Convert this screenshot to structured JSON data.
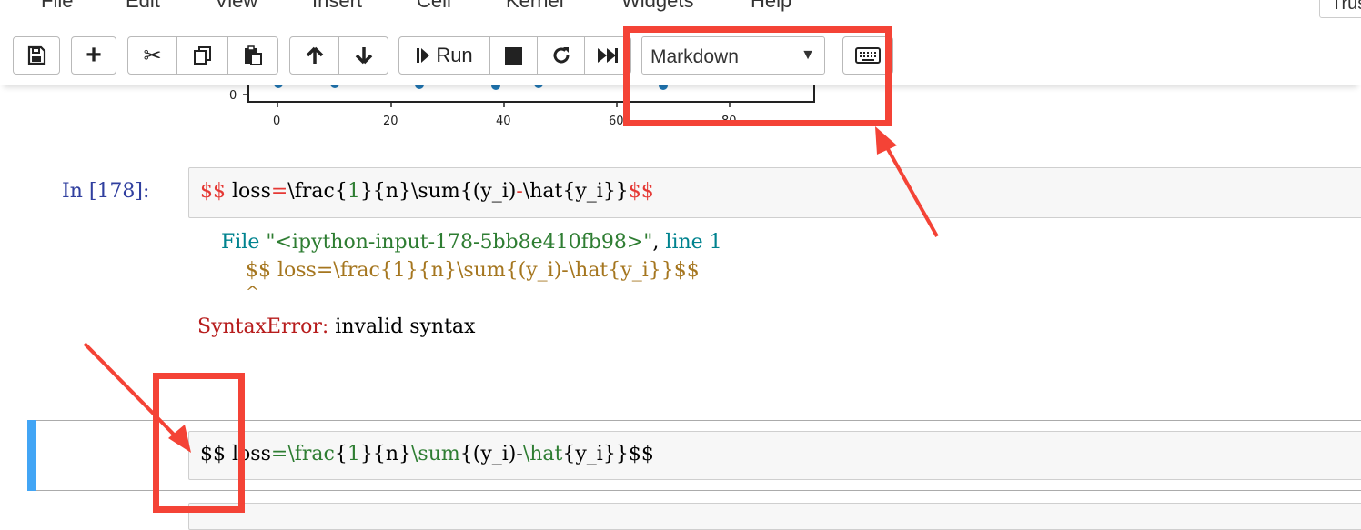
{
  "menubar": {
    "items": [
      "File",
      "Edit",
      "View",
      "Insert",
      "Cell",
      "Kernel",
      "Widgets",
      "Help"
    ],
    "trusted": "Trus"
  },
  "toolbar": {
    "run_label": "Run",
    "cell_type_value": "Markdown"
  },
  "plot": {
    "xticks": [
      "0",
      "20",
      "40",
      "60",
      "80"
    ],
    "yticks": [
      "0"
    ]
  },
  "cell1": {
    "prompt": "In  [178]:",
    "source_delim_open": "$$",
    "source_loss": " loss",
    "source_eq": "=",
    "source_frac": "\\frac",
    "source_b1": "{",
    "source_one": "1",
    "source_b2": "}{",
    "source_n": "n",
    "source_b3": "}",
    "source_sum": "\\sum",
    "source_b4": "{",
    "source_yi": "(y_i)",
    "source_minus": "-",
    "source_hat": "\\hat",
    "source_b5": "{",
    "source_yi2": "y_i",
    "source_b6": "}}",
    "source_delim_close": "$$"
  },
  "error": {
    "file_prefix": "File ",
    "file_name": "\"<ipython-input-178-5bb8e410fb98>\"",
    "file_sep": ", ",
    "line_label": "line 1",
    "code_line": "$$ loss=\\frac{1}{n}\\sum{(y_i)-\\hat{y_i}}$$",
    "caret": "^",
    "error_name": "SyntaxError:",
    "error_msg": " invalid syntax"
  },
  "cell2": {
    "s_open": "$$ ",
    "s_loss": "loss",
    "s_eq": "=",
    "s_frac": "\\frac",
    "s_b1": "{",
    "s_one": "1",
    "s_b2": "}{",
    "s_n": "n",
    "s_b3": "}",
    "s_sum": "\\sum",
    "s_b4": "{",
    "s_yi": "(y_i)-",
    "s_hat": "\\hat",
    "s_b5": "{",
    "s_yi2": "y_i",
    "s_b6": "}}",
    "s_close": "$$"
  },
  "colors": {
    "annotation": "#f44336",
    "selected_bar": "#42a5f5",
    "prompt": "#303f9f"
  }
}
